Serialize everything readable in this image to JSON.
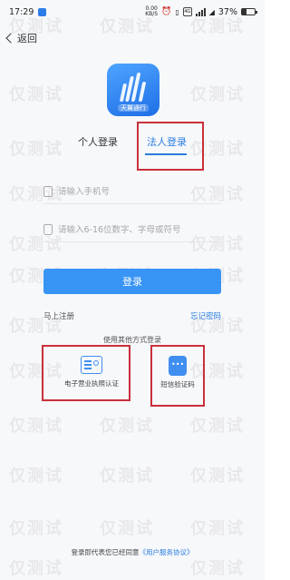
{
  "status_bar": {
    "time": "17:29",
    "net_speed_value": "0.00",
    "net_speed_unit": "KB/S",
    "battery": "37%",
    "battery_level": 0.37
  },
  "nav": {
    "back_label": "返回"
  },
  "logo": {
    "text": "天翼通行"
  },
  "tabs": [
    {
      "label": "个人登录"
    },
    {
      "label": "法人登录"
    }
  ],
  "form": {
    "phone_placeholder": "请输入手机号",
    "password_placeholder": "请输入6-16位数字、字母或符号",
    "login_label": "登录",
    "register_label": "马上注册",
    "forgot_label": "忘记密码"
  },
  "other": {
    "title": "使用其他方式登录",
    "methods": [
      {
        "label": "电子营业执照认证",
        "icon": "license-card-icon"
      },
      {
        "label": "短信验证码",
        "icon": "sms-bubble-icon"
      }
    ]
  },
  "footer": {
    "agree_prefix": "登录即代表您已经同意",
    "agree_link": "《用户服务协议》"
  },
  "watermark": {
    "text": "仅测试"
  },
  "colors": {
    "accent": "#2a7de1",
    "button": "#3894f5",
    "highlight": "#c9303b"
  }
}
